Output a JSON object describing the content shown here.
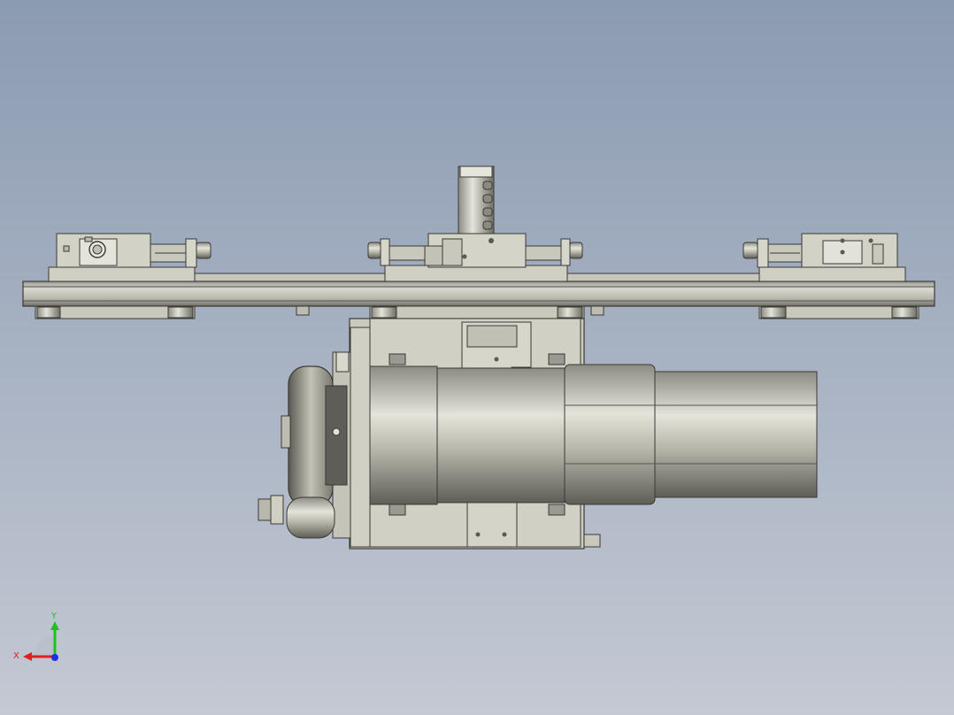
{
  "viewport": {
    "background_top": "#8b9bb2",
    "background_bottom": "#c4c9d3"
  },
  "triad": {
    "x_label": "X",
    "y_label": "Y",
    "x_color": "#e02020",
    "y_color": "#20c020",
    "z_color": "#2030e0"
  },
  "model": {
    "part_color": "#c8c8bd",
    "edge_color": "#3a3a36",
    "shadow_color": "#8e8e84"
  }
}
